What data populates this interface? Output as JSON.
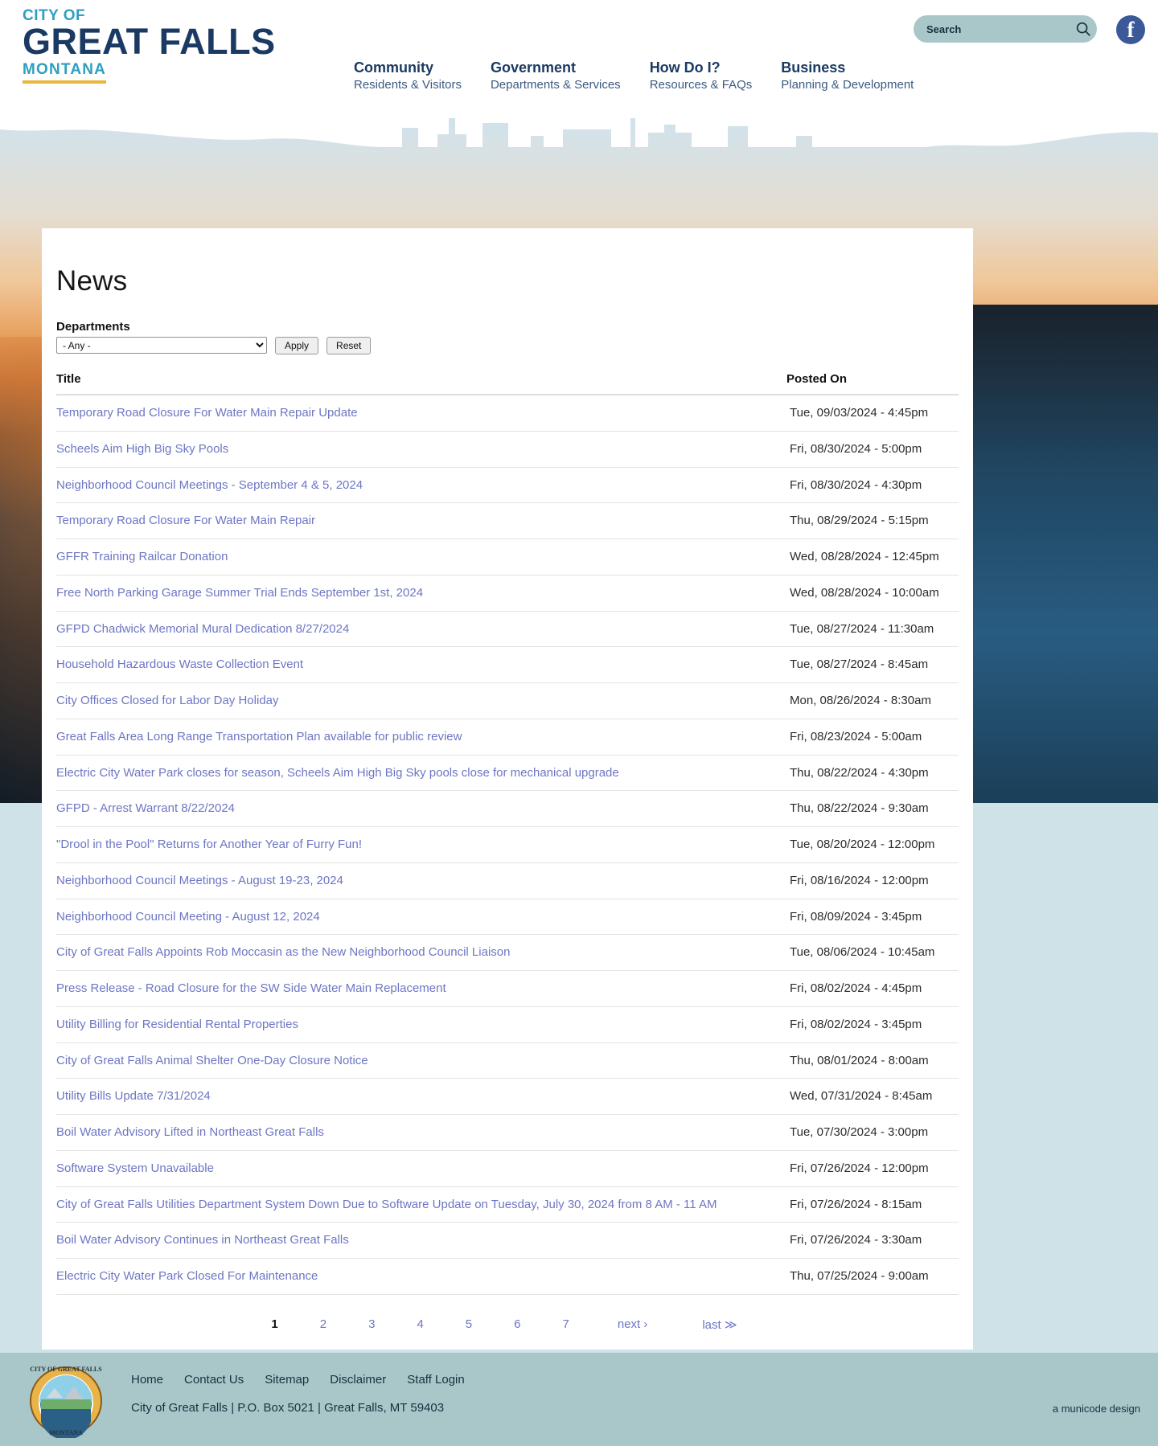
{
  "header": {
    "logo": {
      "line1": "CITY OF",
      "line2": "GREAT FALLS",
      "line3": "MONTANA"
    },
    "nav": [
      {
        "title": "Community",
        "subtitle": "Residents & Visitors"
      },
      {
        "title": "Government",
        "subtitle": "Departments & Services"
      },
      {
        "title": "How Do I?",
        "subtitle": "Resources & FAQs"
      },
      {
        "title": "Business",
        "subtitle": "Planning & Development"
      }
    ],
    "search": {
      "placeholder": "Search",
      "value": "",
      "icon": "search-icon"
    },
    "social": {
      "facebook_glyph": "f"
    }
  },
  "main": {
    "page_title": "News",
    "filter": {
      "label": "Departments",
      "selected": "- Any -",
      "options": [
        "- Any -"
      ],
      "apply_label": "Apply",
      "reset_label": "Reset"
    },
    "table": {
      "columns": [
        "Title",
        "Posted On"
      ],
      "rows": [
        {
          "title": "Temporary Road Closure For Water Main Repair Update",
          "posted": "Tue, 09/03/2024 - 4:45pm"
        },
        {
          "title": "Scheels Aim High Big Sky Pools",
          "posted": "Fri, 08/30/2024 - 5:00pm"
        },
        {
          "title": "Neighborhood Council Meetings - September 4 & 5, 2024",
          "posted": "Fri, 08/30/2024 - 4:30pm"
        },
        {
          "title": "Temporary Road Closure For Water Main Repair",
          "posted": "Thu, 08/29/2024 - 5:15pm"
        },
        {
          "title": "GFFR Training Railcar Donation",
          "posted": "Wed, 08/28/2024 - 12:45pm"
        },
        {
          "title": "Free North Parking Garage Summer Trial Ends September 1st, 2024",
          "posted": "Wed, 08/28/2024 - 10:00am"
        },
        {
          "title": "GFPD Chadwick Memorial Mural Dedication 8/27/2024",
          "posted": "Tue, 08/27/2024 - 11:30am"
        },
        {
          "title": "Household Hazardous Waste Collection Event",
          "posted": "Tue, 08/27/2024 - 8:45am"
        },
        {
          "title": "City Offices Closed for Labor Day Holiday",
          "posted": "Mon, 08/26/2024 - 8:30am"
        },
        {
          "title": "Great Falls Area Long Range Transportation Plan available for public review",
          "posted": "Fri, 08/23/2024 - 5:00am"
        },
        {
          "title": "Electric City Water Park closes for season, Scheels Aim High Big Sky pools close for mechanical upgrade",
          "posted": "Thu, 08/22/2024 - 4:30pm"
        },
        {
          "title": "GFPD - Arrest Warrant 8/22/2024",
          "posted": "Thu, 08/22/2024 - 9:30am"
        },
        {
          "title": "\"Drool in the Pool\" Returns for Another Year of Furry Fun!",
          "posted": "Tue, 08/20/2024 - 12:00pm"
        },
        {
          "title": "Neighborhood Council Meetings - August 19-23, 2024",
          "posted": "Fri, 08/16/2024 - 12:00pm"
        },
        {
          "title": "Neighborhood Council Meeting - August 12, 2024",
          "posted": "Fri, 08/09/2024 - 3:45pm"
        },
        {
          "title": "City of Great Falls Appoints Rob Moccasin as the New Neighborhood Council Liaison",
          "posted": "Tue, 08/06/2024 - 10:45am"
        },
        {
          "title": "Press Release - Road Closure for the SW Side Water Main Replacement",
          "posted": "Fri, 08/02/2024 - 4:45pm"
        },
        {
          "title": "Utility Billing for Residential Rental Properties",
          "posted": "Fri, 08/02/2024 - 3:45pm"
        },
        {
          "title": "City of Great Falls Animal Shelter One-Day Closure Notice",
          "posted": "Thu, 08/01/2024 - 8:00am"
        },
        {
          "title": "Utility Bills Update 7/31/2024",
          "posted": "Wed, 07/31/2024 - 8:45am"
        },
        {
          "title": "Boil Water Advisory Lifted in Northeast Great Falls",
          "posted": "Tue, 07/30/2024 - 3:00pm"
        },
        {
          "title": "Software System Unavailable",
          "posted": "Fri, 07/26/2024 - 12:00pm"
        },
        {
          "title": "City of Great Falls Utilities Department System Down Due to Software Update on Tuesday, July 30, 2024 from 8 AM - 11 AM",
          "posted": "Fri, 07/26/2024 - 8:15am"
        },
        {
          "title": "Boil Water Advisory Continues in Northeast Great Falls",
          "posted": "Fri, 07/26/2024 - 3:30am"
        },
        {
          "title": "Electric City Water Park Closed For Maintenance",
          "posted": "Thu, 07/25/2024 - 9:00am"
        }
      ]
    },
    "pagination": {
      "current": "1",
      "pages": [
        "1",
        "2",
        "3",
        "4",
        "5",
        "6",
        "7"
      ],
      "next_label": "next ›",
      "last_label": "last ≫"
    }
  },
  "footer": {
    "links": [
      "Home",
      "Contact Us",
      "Sitemap",
      "Disclaimer",
      "Staff Login"
    ],
    "address": "City of Great Falls | P.O. Box 5021 | Great Falls, MT 59403",
    "credit": "a municode design",
    "seal_text": {
      "top": "CITY OF GREAT FALLS",
      "bottom": "MONTANA"
    }
  },
  "colors": {
    "brand_navy": "#1b3a63",
    "brand_teal": "#2e9fc0",
    "brand_gold": "#e9b53c",
    "footer_bg": "#a9c7c9",
    "link": "#6d76c4"
  }
}
